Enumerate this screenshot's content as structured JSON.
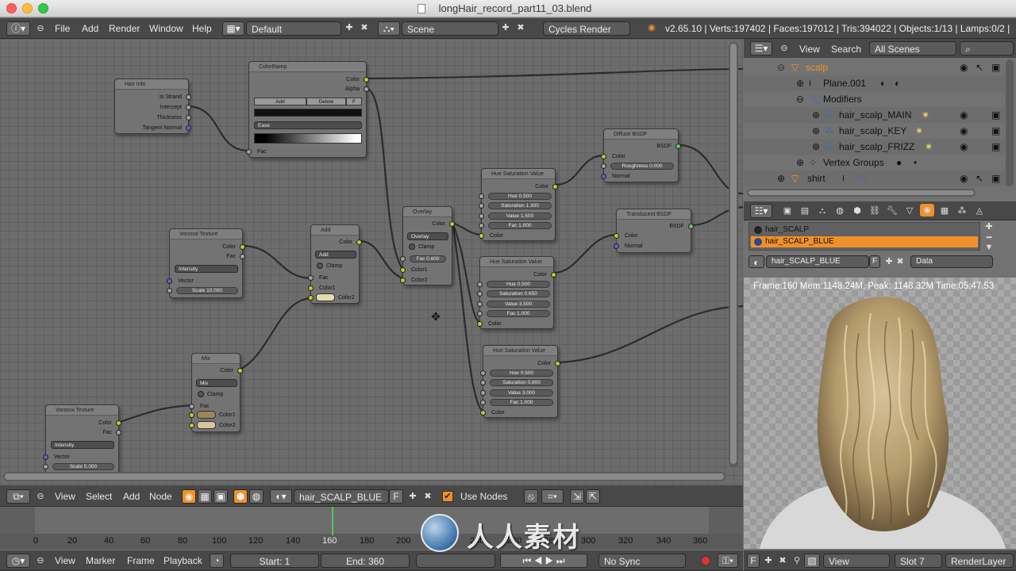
{
  "window": {
    "title": "longHair_record_part11_03.blend"
  },
  "info_header": {
    "menus": [
      "File",
      "Add",
      "Render",
      "Window",
      "Help"
    ],
    "layout": "Default",
    "scene": "Scene",
    "engine": "Cycles Render",
    "stats": "v2.65.10 | Verts:197402 | Faces:197012 | Tris:394022 | Objects:1/13 | Lamps:0/2 | M"
  },
  "outliner": {
    "menus": [
      "View",
      "Search"
    ],
    "filter": "All Scenes",
    "items": [
      {
        "label": "scalp"
      },
      {
        "label": "Plane.001"
      },
      {
        "label": "Modifiers"
      },
      {
        "label": "hair_scalp_MAIN"
      },
      {
        "label": "hair_scalp_KEY"
      },
      {
        "label": "hair_scalp_FRIZZ"
      },
      {
        "label": "Vertex Groups"
      },
      {
        "label": "shirt"
      }
    ]
  },
  "properties": {
    "materials": [
      "hair_SCALP",
      "hair_SCALP_BLUE"
    ],
    "active_material": "hair_SCALP_BLUE",
    "material_field": "hair_SCALP_BLUE",
    "fake_user": "F",
    "link_mode": "Data"
  },
  "render": {
    "status": "Frame:160 Mem:1148.24M, Peak: 1148.32M Time:05:47.53"
  },
  "nodes": {
    "hair_info": {
      "title": "Hair Info",
      "outputs": [
        "Is Strand",
        "Intercept",
        "Thickness",
        "Tangent Normal"
      ]
    },
    "colorramp": {
      "title": "ColorRamp",
      "add": "Add",
      "delete": "Delete",
      "f": "F",
      "interp": "Ease",
      "outputs": [
        "Color",
        "Alpha"
      ],
      "input": "Fac"
    },
    "voronoi1": {
      "title": "Voronoi Texture",
      "mode": "Intensity",
      "outputs": [
        "Color",
        "Fac"
      ],
      "vector": "Vector",
      "scale": "Scale 10.000"
    },
    "add": {
      "title": "Add",
      "mode": "Add",
      "clamp": "Clamp",
      "out": "Color",
      "inputs": [
        "Fac",
        "Color1",
        "Color2"
      ]
    },
    "mix": {
      "title": "Mix",
      "mode": "Mix",
      "clamp": "Clamp",
      "out": "Color",
      "inputs": [
        "Fac",
        "Color1",
        "Color2"
      ]
    },
    "voronoi2": {
      "title": "Voronoi Texture",
      "mode": "Intensity",
      "outputs": [
        "Color",
        "Fac"
      ],
      "vector": "Vector",
      "scale": "Scale 5.000"
    },
    "overlay": {
      "title": "Overlay",
      "mode": "Overlay",
      "clamp": "Clamp",
      "out": "Color",
      "fac": "Fac 0.600",
      "inputs": [
        "Color1",
        "Color2"
      ]
    },
    "hsv1": {
      "title": "Hue Saturation Value",
      "out": "Color",
      "fields": [
        "Hue 0.500",
        "Saturation 1.300",
        "Value 1.500",
        "Fac 1.000"
      ],
      "input": "Color"
    },
    "hsv2": {
      "title": "Hue Saturation Value",
      "out": "Color",
      "fields": [
        "Hue 0.500",
        "Saturation 0.650",
        "Value 3.500",
        "Fac 1.000"
      ],
      "input": "Color"
    },
    "hsv3": {
      "title": "Hue Saturation Value",
      "out": "Color",
      "fields": [
        "Hue 0.500",
        "Saturation 0.800",
        "Value 3.000",
        "Fac 1.000"
      ],
      "input": "Color"
    },
    "diffuse": {
      "title": "Diffuse BSDF",
      "out": "BSDF",
      "inputs": [
        "Color",
        "Roughness 0.000",
        "Normal"
      ]
    },
    "translucent": {
      "title": "Translucent BSDF",
      "out": "BSDF",
      "inputs": [
        "Color",
        "Normal"
      ]
    }
  },
  "node_header": {
    "menus": [
      "View",
      "Select",
      "Add",
      "Node"
    ],
    "material": "hair_SCALP_BLUE",
    "fake_user": "F",
    "use_nodes_label": "Use Nodes",
    "use_nodes": true
  },
  "timeline": {
    "ticks": [
      "0",
      "20",
      "40",
      "60",
      "80",
      "100",
      "120",
      "140",
      "160",
      "180",
      "200",
      "220",
      "240",
      "260",
      "280",
      "300",
      "320",
      "340",
      "360"
    ],
    "current_frame": 160,
    "menus": [
      "View",
      "Marker",
      "Frame",
      "Playback"
    ],
    "start": "Start: 1",
    "end": "End: 360",
    "sync": "No Sync"
  },
  "image_editor_header": {
    "f": "F",
    "view": "View",
    "slot": "Slot 7",
    "layer": "RenderLayer"
  },
  "colors": {
    "accent": "#f0902a",
    "socket_color": "#c7c729",
    "socket_shader": "#63c763",
    "socket_vector": "#6363c7"
  }
}
